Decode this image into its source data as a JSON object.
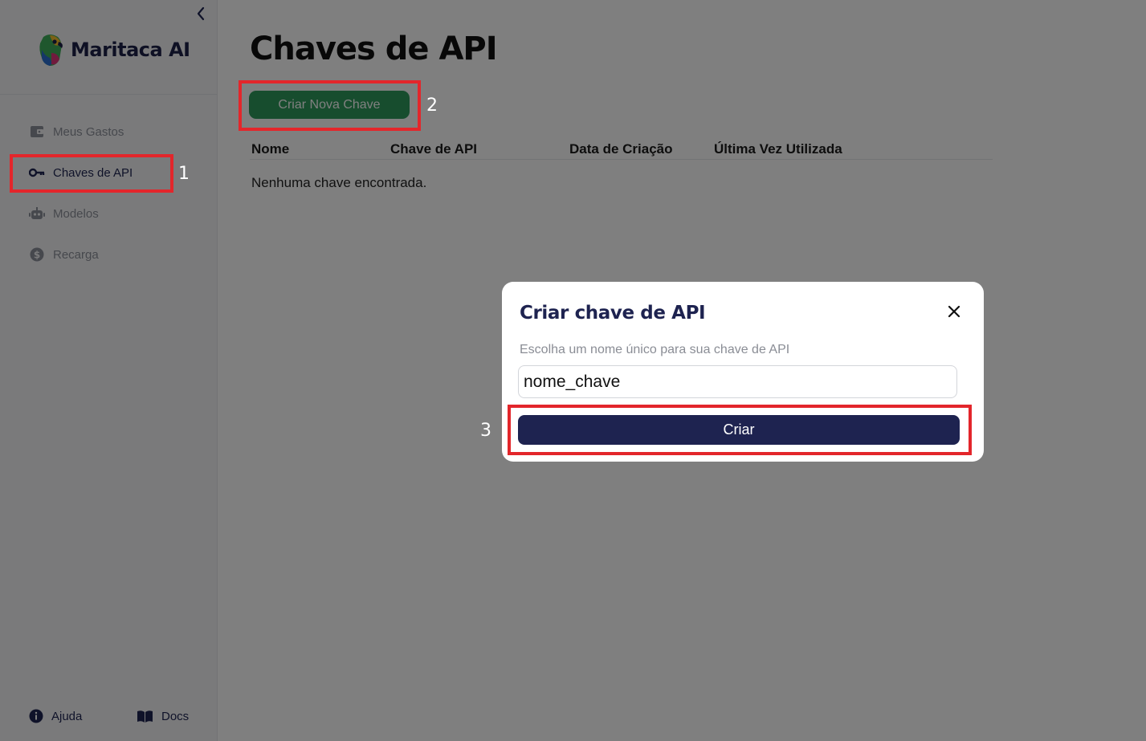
{
  "sidebar": {
    "brand": "Maritaca AI",
    "items": [
      {
        "label": "Meus Gastos",
        "icon": "wallet-icon"
      },
      {
        "label": "Chaves de API",
        "icon": "key-icon",
        "active": true
      },
      {
        "label": "Modelos",
        "icon": "robot-icon"
      },
      {
        "label": "Recarga",
        "icon": "dollar-icon"
      }
    ],
    "footer": [
      {
        "label": "Ajuda",
        "icon": "info-icon"
      },
      {
        "label": "Docs",
        "icon": "book-icon"
      }
    ]
  },
  "main": {
    "title": "Chaves de API",
    "create_button": "Criar Nova Chave",
    "table": {
      "columns": [
        "Nome",
        "Chave de API",
        "Data de Criação",
        "Última Vez Utilizada"
      ],
      "empty_message": "Nenhuma chave encontrada."
    }
  },
  "modal": {
    "title": "Criar chave de API",
    "hint": "Escolha um nome único para sua chave de API",
    "input_value": "nome_chave",
    "submit_label": "Criar"
  },
  "annotations": [
    "1",
    "2",
    "3"
  ],
  "colors": {
    "primary": "#1e2350",
    "create_button": "#2f9a5c",
    "annotation": "#e3262b"
  }
}
